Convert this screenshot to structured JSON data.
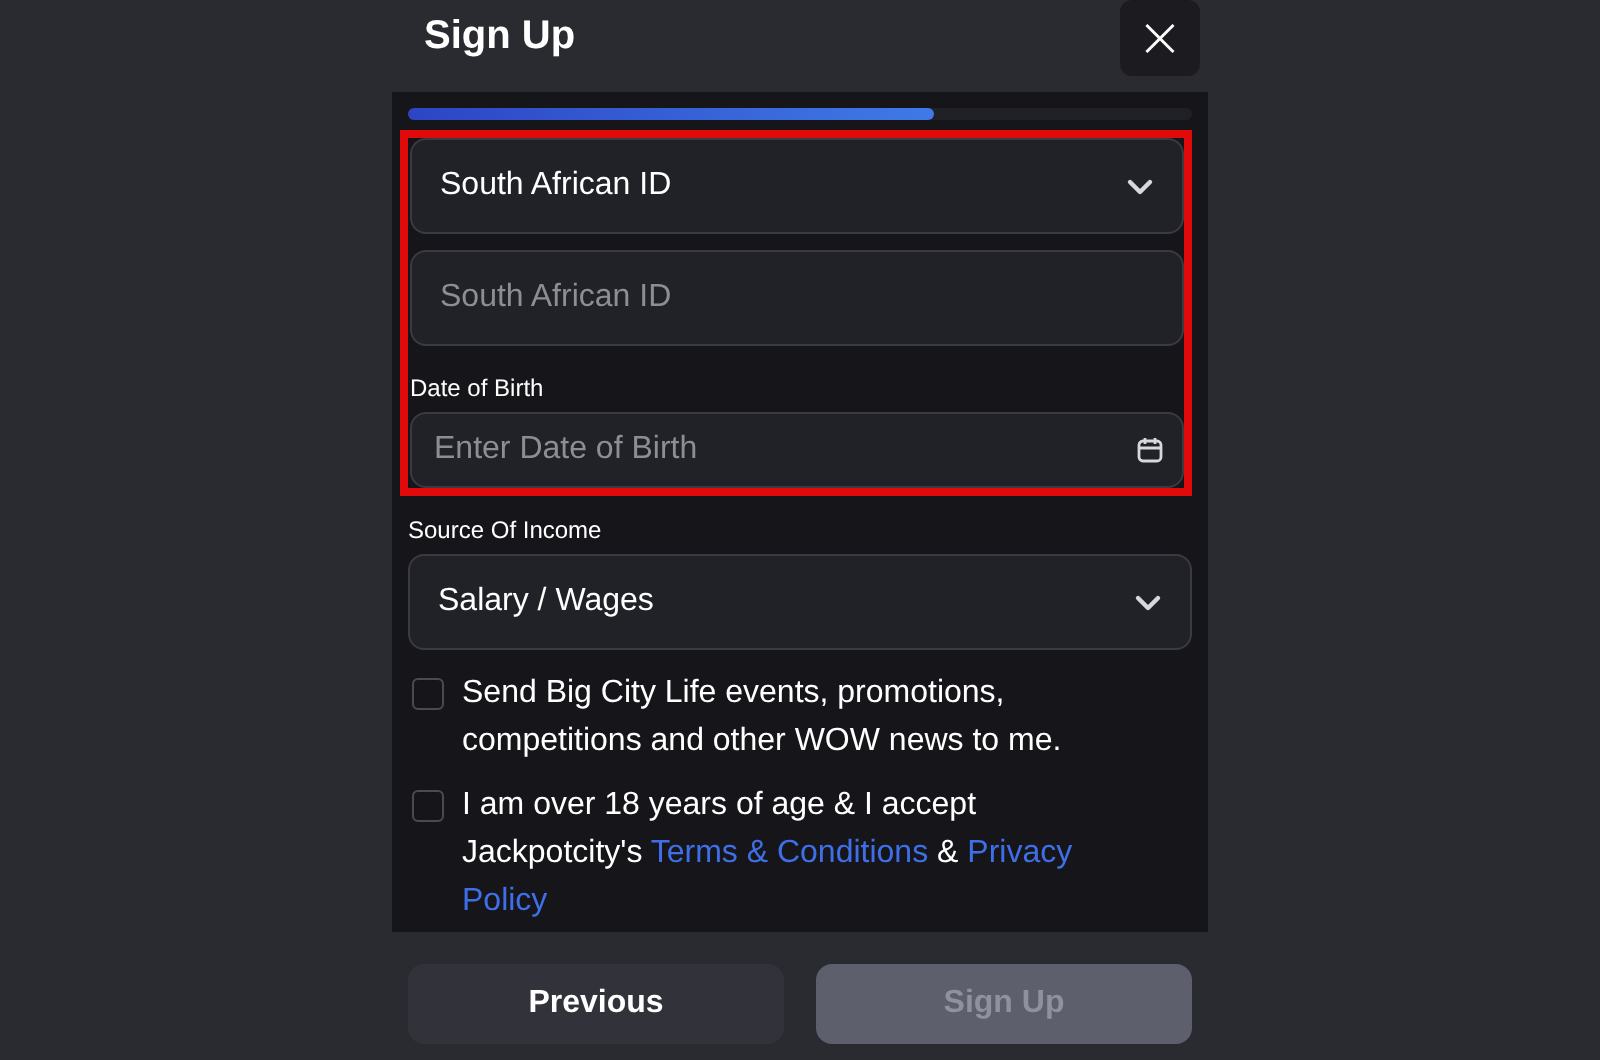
{
  "dialog": {
    "title": "Sign Up",
    "close_icon": "×"
  },
  "progress": {
    "level": 0.67
  },
  "highlighted": true,
  "id_type": {
    "value": "South African ID"
  },
  "id_number": {
    "placeholder": "South African ID"
  },
  "date_of_birth": {
    "label": "Date of Birth",
    "placeholder": "Enter Date of Birth"
  },
  "income": {
    "label": "Source Of Income",
    "value": "Salary / Wages"
  },
  "consents": [
    {
      "checked": false,
      "parts": [
        {
          "kind": "text",
          "text": "Send Big City Life events, promotions, competitions and other WOW news to me."
        }
      ]
    },
    {
      "checked": false,
      "parts": [
        {
          "kind": "text",
          "text": "I am over 18 years of age & I accept Jackpotcity's "
        },
        {
          "kind": "link",
          "text": "Terms & Conditions"
        },
        {
          "kind": "text",
          "text": " & "
        },
        {
          "kind": "link",
          "text": "Privacy"
        },
        {
          "kind": "link",
          "text": "Policy"
        }
      ]
    }
  ],
  "buttons": [
    {
      "label": "Previous",
      "disabled": false
    },
    {
      "label": "Sign Up",
      "disabled": true
    }
  ]
}
